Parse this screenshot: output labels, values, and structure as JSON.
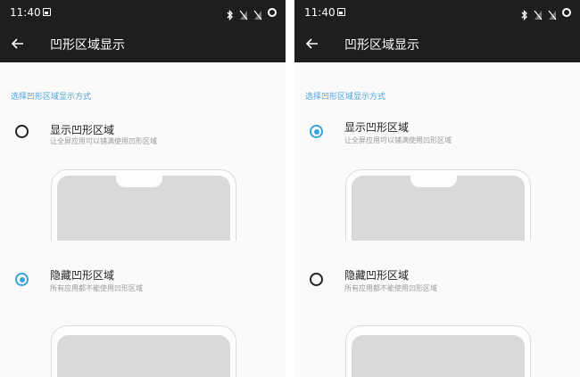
{
  "status_bar": {
    "time": "11:40",
    "icons": [
      "picture-icon",
      "bluetooth-icon",
      "no-sim-icon",
      "no-signal-icon",
      "loading-ring-icon"
    ]
  },
  "app_bar": {
    "title": "凹形区域显示",
    "back_icon": "back-arrow-icon"
  },
  "section_header": "选择凹形区域显示方式",
  "options": [
    {
      "title": "显示凹形区域",
      "description": "让全屏应用可以铺满使用凹形区域"
    },
    {
      "title": "隐藏凹形区域",
      "description": "所有应用都不能使用凹形区域"
    }
  ],
  "screens": [
    {
      "selected_option": 1
    },
    {
      "selected_option": 0
    }
  ],
  "colors": {
    "bar_background": "#1e1e1e",
    "accent": "#36a6d9",
    "page_background": "#fafafa"
  }
}
